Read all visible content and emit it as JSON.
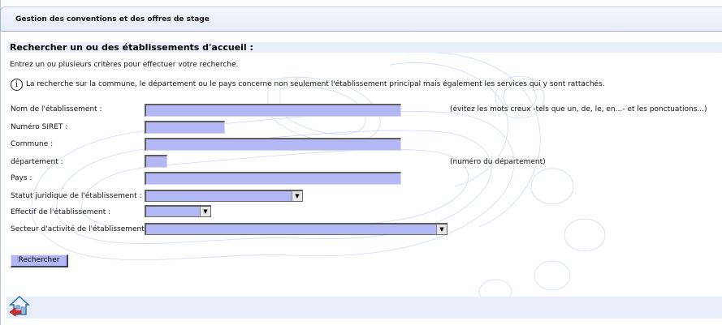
{
  "header": {
    "app_title": "Gestion des conventions et des offres de stage"
  },
  "search": {
    "title": "Rechercher un ou des établissements d'accueil :",
    "intro": "Entrez un ou plusieurs critères pour effectuer votre recherche.",
    "info": "La recherche sur la commune, le département ou le pays concerne non seulement l'établissement principal mais également les services qui y sont rattachés."
  },
  "form": {
    "nom": {
      "label": "Nom de l'établissement :",
      "value": "",
      "hint": "(évitez les mots creux -tels que un, de, le, en...- et les ponctuations...)"
    },
    "siret": {
      "label": "Numéro SIRET :",
      "value": ""
    },
    "commune": {
      "label": "Commune :",
      "value": ""
    },
    "departement": {
      "label": "département :",
      "value": "",
      "hint": "(numéro du département)"
    },
    "pays": {
      "label": "Pays :",
      "value": ""
    },
    "statut": {
      "label": "Statut juridique de l'établissement :",
      "selected": ""
    },
    "effectif": {
      "label": "Effectif de l'établissement :",
      "selected": ""
    },
    "secteur": {
      "label": "Secteur d'activité de l'établissement :",
      "selected": ""
    },
    "submit_label": "Rechercher"
  },
  "icons": {
    "info": "info-circle-icon",
    "home": "home-back-icon",
    "arrow": "chevron-down-icon"
  },
  "colors": {
    "field_bg": "#b3b7f4",
    "bar_bg": "#e8edfa",
    "border": "#9fb2d4"
  }
}
